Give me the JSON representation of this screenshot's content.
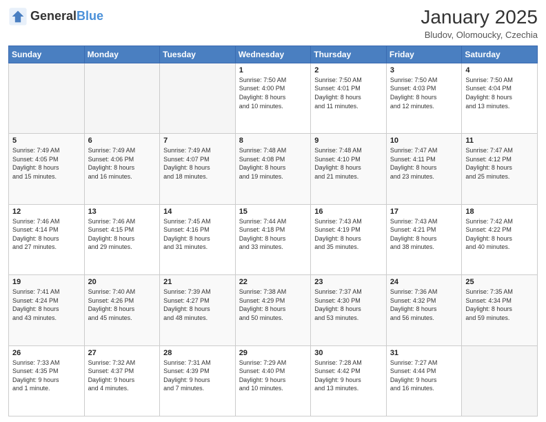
{
  "logo": {
    "text_general": "General",
    "text_blue": "Blue"
  },
  "header": {
    "month": "January 2025",
    "location": "Bludov, Olomoucky, Czechia"
  },
  "weekdays": [
    "Sunday",
    "Monday",
    "Tuesday",
    "Wednesday",
    "Thursday",
    "Friday",
    "Saturday"
  ],
  "weeks": [
    [
      {
        "day": "",
        "info": ""
      },
      {
        "day": "",
        "info": ""
      },
      {
        "day": "",
        "info": ""
      },
      {
        "day": "1",
        "info": "Sunrise: 7:50 AM\nSunset: 4:00 PM\nDaylight: 8 hours\nand 10 minutes."
      },
      {
        "day": "2",
        "info": "Sunrise: 7:50 AM\nSunset: 4:01 PM\nDaylight: 8 hours\nand 11 minutes."
      },
      {
        "day": "3",
        "info": "Sunrise: 7:50 AM\nSunset: 4:03 PM\nDaylight: 8 hours\nand 12 minutes."
      },
      {
        "day": "4",
        "info": "Sunrise: 7:50 AM\nSunset: 4:04 PM\nDaylight: 8 hours\nand 13 minutes."
      }
    ],
    [
      {
        "day": "5",
        "info": "Sunrise: 7:49 AM\nSunset: 4:05 PM\nDaylight: 8 hours\nand 15 minutes."
      },
      {
        "day": "6",
        "info": "Sunrise: 7:49 AM\nSunset: 4:06 PM\nDaylight: 8 hours\nand 16 minutes."
      },
      {
        "day": "7",
        "info": "Sunrise: 7:49 AM\nSunset: 4:07 PM\nDaylight: 8 hours\nand 18 minutes."
      },
      {
        "day": "8",
        "info": "Sunrise: 7:48 AM\nSunset: 4:08 PM\nDaylight: 8 hours\nand 19 minutes."
      },
      {
        "day": "9",
        "info": "Sunrise: 7:48 AM\nSunset: 4:10 PM\nDaylight: 8 hours\nand 21 minutes."
      },
      {
        "day": "10",
        "info": "Sunrise: 7:47 AM\nSunset: 4:11 PM\nDaylight: 8 hours\nand 23 minutes."
      },
      {
        "day": "11",
        "info": "Sunrise: 7:47 AM\nSunset: 4:12 PM\nDaylight: 8 hours\nand 25 minutes."
      }
    ],
    [
      {
        "day": "12",
        "info": "Sunrise: 7:46 AM\nSunset: 4:14 PM\nDaylight: 8 hours\nand 27 minutes."
      },
      {
        "day": "13",
        "info": "Sunrise: 7:46 AM\nSunset: 4:15 PM\nDaylight: 8 hours\nand 29 minutes."
      },
      {
        "day": "14",
        "info": "Sunrise: 7:45 AM\nSunset: 4:16 PM\nDaylight: 8 hours\nand 31 minutes."
      },
      {
        "day": "15",
        "info": "Sunrise: 7:44 AM\nSunset: 4:18 PM\nDaylight: 8 hours\nand 33 minutes."
      },
      {
        "day": "16",
        "info": "Sunrise: 7:43 AM\nSunset: 4:19 PM\nDaylight: 8 hours\nand 35 minutes."
      },
      {
        "day": "17",
        "info": "Sunrise: 7:43 AM\nSunset: 4:21 PM\nDaylight: 8 hours\nand 38 minutes."
      },
      {
        "day": "18",
        "info": "Sunrise: 7:42 AM\nSunset: 4:22 PM\nDaylight: 8 hours\nand 40 minutes."
      }
    ],
    [
      {
        "day": "19",
        "info": "Sunrise: 7:41 AM\nSunset: 4:24 PM\nDaylight: 8 hours\nand 43 minutes."
      },
      {
        "day": "20",
        "info": "Sunrise: 7:40 AM\nSunset: 4:26 PM\nDaylight: 8 hours\nand 45 minutes."
      },
      {
        "day": "21",
        "info": "Sunrise: 7:39 AM\nSunset: 4:27 PM\nDaylight: 8 hours\nand 48 minutes."
      },
      {
        "day": "22",
        "info": "Sunrise: 7:38 AM\nSunset: 4:29 PM\nDaylight: 8 hours\nand 50 minutes."
      },
      {
        "day": "23",
        "info": "Sunrise: 7:37 AM\nSunset: 4:30 PM\nDaylight: 8 hours\nand 53 minutes."
      },
      {
        "day": "24",
        "info": "Sunrise: 7:36 AM\nSunset: 4:32 PM\nDaylight: 8 hours\nand 56 minutes."
      },
      {
        "day": "25",
        "info": "Sunrise: 7:35 AM\nSunset: 4:34 PM\nDaylight: 8 hours\nand 59 minutes."
      }
    ],
    [
      {
        "day": "26",
        "info": "Sunrise: 7:33 AM\nSunset: 4:35 PM\nDaylight: 9 hours\nand 1 minute."
      },
      {
        "day": "27",
        "info": "Sunrise: 7:32 AM\nSunset: 4:37 PM\nDaylight: 9 hours\nand 4 minutes."
      },
      {
        "day": "28",
        "info": "Sunrise: 7:31 AM\nSunset: 4:39 PM\nDaylight: 9 hours\nand 7 minutes."
      },
      {
        "day": "29",
        "info": "Sunrise: 7:29 AM\nSunset: 4:40 PM\nDaylight: 9 hours\nand 10 minutes."
      },
      {
        "day": "30",
        "info": "Sunrise: 7:28 AM\nSunset: 4:42 PM\nDaylight: 9 hours\nand 13 minutes."
      },
      {
        "day": "31",
        "info": "Sunrise: 7:27 AM\nSunset: 4:44 PM\nDaylight: 9 hours\nand 16 minutes."
      },
      {
        "day": "",
        "info": ""
      }
    ]
  ]
}
